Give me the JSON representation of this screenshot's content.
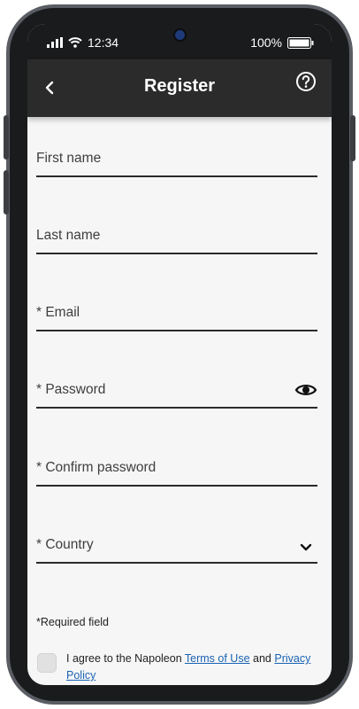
{
  "status_bar": {
    "time": "12:34",
    "battery": "100%"
  },
  "header": {
    "title": "Register"
  },
  "form": {
    "first_name": "First name",
    "last_name": "Last name",
    "email": "* Email",
    "password": "* Password",
    "confirm_password": "* Confirm password",
    "country": "* Country"
  },
  "required_note": "*Required field",
  "terms": {
    "prefix": "I agree to the Napoleon ",
    "terms_link": "Terms of Use",
    "and": " and ",
    "privacy_link": "Privacy Policy"
  },
  "colors": {
    "app_bar": "#2b2b2b",
    "link": "#1a63b4",
    "background": "#f6f6f6"
  }
}
